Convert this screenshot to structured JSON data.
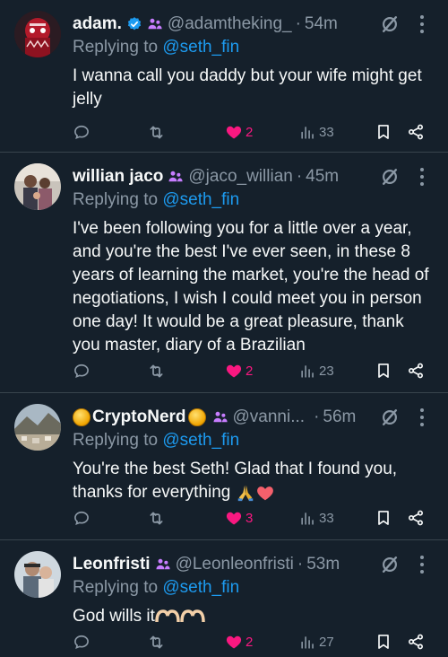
{
  "tweets": [
    {
      "name": "adam.",
      "verified": true,
      "handle": "@adamtheking_",
      "time": "54m",
      "replying_prefix": "Replying to ",
      "mention": "@seth_fin",
      "text": "I wanna call you daddy but your wife might get jelly",
      "likes": "2",
      "views": "33"
    },
    {
      "name": "willian jaco",
      "verified": false,
      "handle": "@jaco_willian",
      "time": "45m",
      "replying_prefix": "Replying to ",
      "mention": "@seth_fin",
      "text": "I've been following you for a little over a year, and you're the best I've ever seen, in these 8 years of learning the market, you're the head of negotiations, I wish I could meet you in person one day! It would be a great pleasure, thank you master, diary of a Brazilian",
      "likes": "2",
      "views": "23"
    },
    {
      "name": "CryptoNerd",
      "verified": false,
      "handle": "@vanni...",
      "time": "56m",
      "replying_prefix": "Replying to ",
      "mention": "@seth_fin",
      "text": "You're the best Seth! Glad that I found you, thanks for everything",
      "likes": "3",
      "views": "33"
    },
    {
      "name": "Leonfristi",
      "verified": false,
      "handle": "@Leonleonfristi",
      "time": "53m",
      "replying_prefix": "Replying to ",
      "mention": "@seth_fin",
      "text": "God wills it",
      "likes": "2",
      "views": "27"
    }
  ],
  "icons": {
    "reply": "reply-icon",
    "repost": "repost-icon",
    "like": "heart-icon",
    "views": "views-icon",
    "bookmark": "bookmark-icon",
    "share": "share-icon",
    "grok": "grok-icon",
    "more": "more-icon"
  },
  "colors": {
    "background": "#15202b",
    "text": "#f7f9f9",
    "muted": "#8b98a5",
    "link": "#1d9bf0",
    "like": "#f91880",
    "subscriber": "#c77dff"
  }
}
